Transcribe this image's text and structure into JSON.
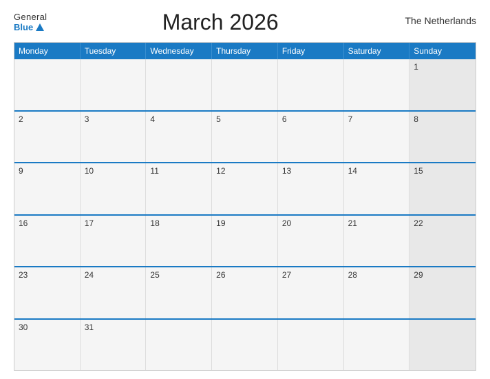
{
  "header": {
    "logo_general": "General",
    "logo_blue": "Blue",
    "title": "March 2026",
    "country": "The Netherlands"
  },
  "calendar": {
    "day_headers": [
      "Monday",
      "Tuesday",
      "Wednesday",
      "Thursday",
      "Friday",
      "Saturday",
      "Sunday"
    ],
    "weeks": [
      [
        {
          "num": "",
          "empty": true
        },
        {
          "num": "",
          "empty": true
        },
        {
          "num": "",
          "empty": true
        },
        {
          "num": "",
          "empty": true
        },
        {
          "num": "",
          "empty": true
        },
        {
          "num": "",
          "empty": true
        },
        {
          "num": "1",
          "sunday": true
        }
      ],
      [
        {
          "num": "2"
        },
        {
          "num": "3"
        },
        {
          "num": "4"
        },
        {
          "num": "5"
        },
        {
          "num": "6"
        },
        {
          "num": "7"
        },
        {
          "num": "8",
          "sunday": true
        }
      ],
      [
        {
          "num": "9"
        },
        {
          "num": "10"
        },
        {
          "num": "11"
        },
        {
          "num": "12"
        },
        {
          "num": "13"
        },
        {
          "num": "14"
        },
        {
          "num": "15",
          "sunday": true
        }
      ],
      [
        {
          "num": "16"
        },
        {
          "num": "17"
        },
        {
          "num": "18"
        },
        {
          "num": "19"
        },
        {
          "num": "20"
        },
        {
          "num": "21"
        },
        {
          "num": "22",
          "sunday": true
        }
      ],
      [
        {
          "num": "23"
        },
        {
          "num": "24"
        },
        {
          "num": "25"
        },
        {
          "num": "26"
        },
        {
          "num": "27"
        },
        {
          "num": "28"
        },
        {
          "num": "29",
          "sunday": true
        }
      ],
      [
        {
          "num": "30"
        },
        {
          "num": "31"
        },
        {
          "num": "",
          "empty": true
        },
        {
          "num": "",
          "empty": true
        },
        {
          "num": "",
          "empty": true
        },
        {
          "num": "",
          "empty": true
        },
        {
          "num": "",
          "empty": true,
          "sunday": true
        }
      ]
    ]
  }
}
